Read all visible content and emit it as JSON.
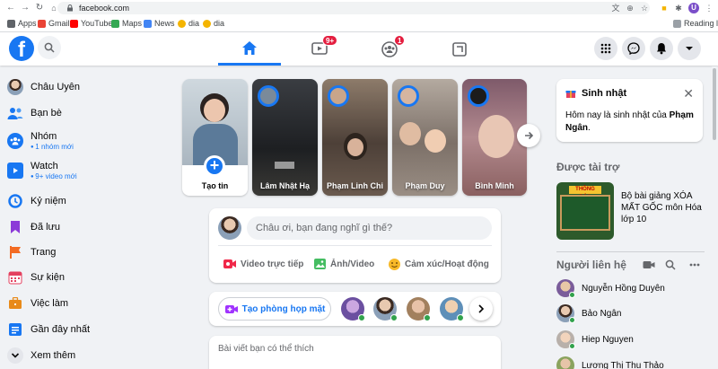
{
  "browser": {
    "url": "facebook.com",
    "reading_list": "Reading list",
    "profile_initial": "U",
    "bookmarks": [
      {
        "label": "Apps",
        "color": "#5f6368"
      },
      {
        "label": "Gmail",
        "color": "#ea4335"
      },
      {
        "label": "YouTube",
        "color": "#ff0000"
      },
      {
        "label": "Maps",
        "color": "#34a853"
      },
      {
        "label": "News",
        "color": "#4285f4"
      },
      {
        "label": "dia",
        "color": "#f4b400"
      },
      {
        "label": "dia",
        "color": "#f4b400"
      }
    ]
  },
  "topbar": {
    "logo": "f",
    "tabs": [
      {
        "icon": "home-icon",
        "active": true
      },
      {
        "icon": "watch-icon",
        "badge": "9+"
      },
      {
        "icon": "groups-icon",
        "badge": "1"
      },
      {
        "icon": "gaming-icon"
      }
    ],
    "right_icons": [
      "menu-grid-icon",
      "messenger-icon",
      "notifications-icon",
      "account-chevron-icon"
    ]
  },
  "sidebar": {
    "items": [
      {
        "label": "Châu Uyên",
        "icon": "profile-avatar"
      },
      {
        "label": "Bạn bè",
        "icon": "friends-icon",
        "color": "#1877f2"
      },
      {
        "label": "Nhóm",
        "sub": "1 nhóm mới",
        "icon": "groups-icon",
        "color": "#1877f2"
      },
      {
        "label": "Watch",
        "sub": "9+ video mới",
        "icon": "watch-icon",
        "color": "#1877f2"
      },
      {
        "label": "Kỷ niệm",
        "icon": "memories-icon",
        "color": "#1877f2"
      },
      {
        "label": "Đã lưu",
        "icon": "saved-icon",
        "color": "#8c3ad8"
      },
      {
        "label": "Trang",
        "icon": "pages-icon",
        "color": "#f36b23"
      },
      {
        "label": "Sự kiện",
        "icon": "events-icon",
        "color": "#e4405f"
      },
      {
        "label": "Việc làm",
        "icon": "jobs-icon",
        "color": "#e88a1a"
      },
      {
        "label": "Gần đây nhất",
        "icon": "recent-icon",
        "color": "#1877f2"
      },
      {
        "label": "Xem thêm",
        "icon": "chevron-down-icon",
        "color": "#606770"
      }
    ]
  },
  "stories": {
    "create_label": "Tạo tin",
    "items": [
      {
        "name": "Lâm Nhật Hạ",
        "bg": "#2a2c30"
      },
      {
        "name": "Phạm Linh Chi",
        "bg": "#6b5a4a"
      },
      {
        "name": "Phạm Duy",
        "bg": "#8a7f76"
      },
      {
        "name": "Bình Minh",
        "bg": "#9a6f7a"
      }
    ]
  },
  "composer": {
    "placeholder": "Châu ơi, bạn đang nghĩ gì thế?",
    "actions": [
      {
        "label": "Video trực tiếp",
        "color": "#f02849"
      },
      {
        "label": "Ảnh/Video",
        "color": "#45bd62"
      },
      {
        "label": "Cảm xúc/Hoạt động",
        "color": "#f7b928"
      }
    ]
  },
  "rooms": {
    "create_label": "Tạo phòng họp mặt"
  },
  "suggested": {
    "label": "Bài viết bạn có thể thích"
  },
  "birthday": {
    "title": "Sinh nhật",
    "text_prefix": "Hôm nay là sinh nhật của ",
    "name": "Phạm Ngân",
    "text_suffix": "."
  },
  "sponsored": {
    "title": "Được tài trợ",
    "ad_text": "Bộ bài giảng XÓA MẤT GỐC môn Hóa lớp 10",
    "ad_badge": "THÔNG BÁO"
  },
  "contacts": {
    "title": "Người liên hệ",
    "items": [
      {
        "name": "Nguyễn Hồng Duyên"
      },
      {
        "name": "Bảo Ngân"
      },
      {
        "name": "Hiep Nguyen"
      },
      {
        "name": "Lương Thị Thu Thảo"
      }
    ]
  }
}
